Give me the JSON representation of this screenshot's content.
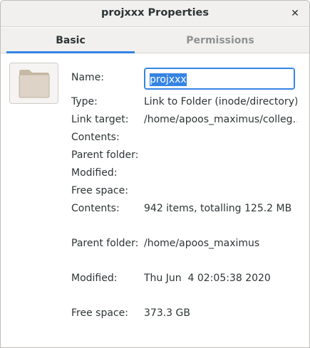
{
  "window": {
    "title": "projxxx Properties",
    "close_glyph": "✕"
  },
  "tabs": [
    {
      "label": "Basic",
      "active": true
    },
    {
      "label": "Permissions",
      "active": false
    }
  ],
  "icon": {
    "name": "folder-icon"
  },
  "fields": {
    "name_label": "Name:",
    "name_value": "projxxx",
    "type_label": "Type:",
    "type_value": "Link to Folder (inode/directory)",
    "link_label": "Link target:",
    "link_value": "/home/apoos_maximus/colleg…",
    "contents_label_1": "Contents:",
    "parent_label_1": "Parent folder:",
    "modified_label_1": "Modified:",
    "free_label_1": "Free space:",
    "contents_label_2": "Contents:",
    "contents_value": "942 items, totalling 125.2 MB",
    "parent_label_2": "Parent folder:",
    "parent_value": "/home/apoos_maximus",
    "modified_label_2": "Modified:",
    "modified_value": "Thu Jun  4 02:05:38 2020",
    "free_label_2": "Free space:",
    "free_value": "373.3 GB"
  },
  "colors": {
    "accent": "#3584e4",
    "header_bg": "#f1f0ee",
    "text": "#2e3436",
    "inactive_tab": "#8f9293"
  }
}
